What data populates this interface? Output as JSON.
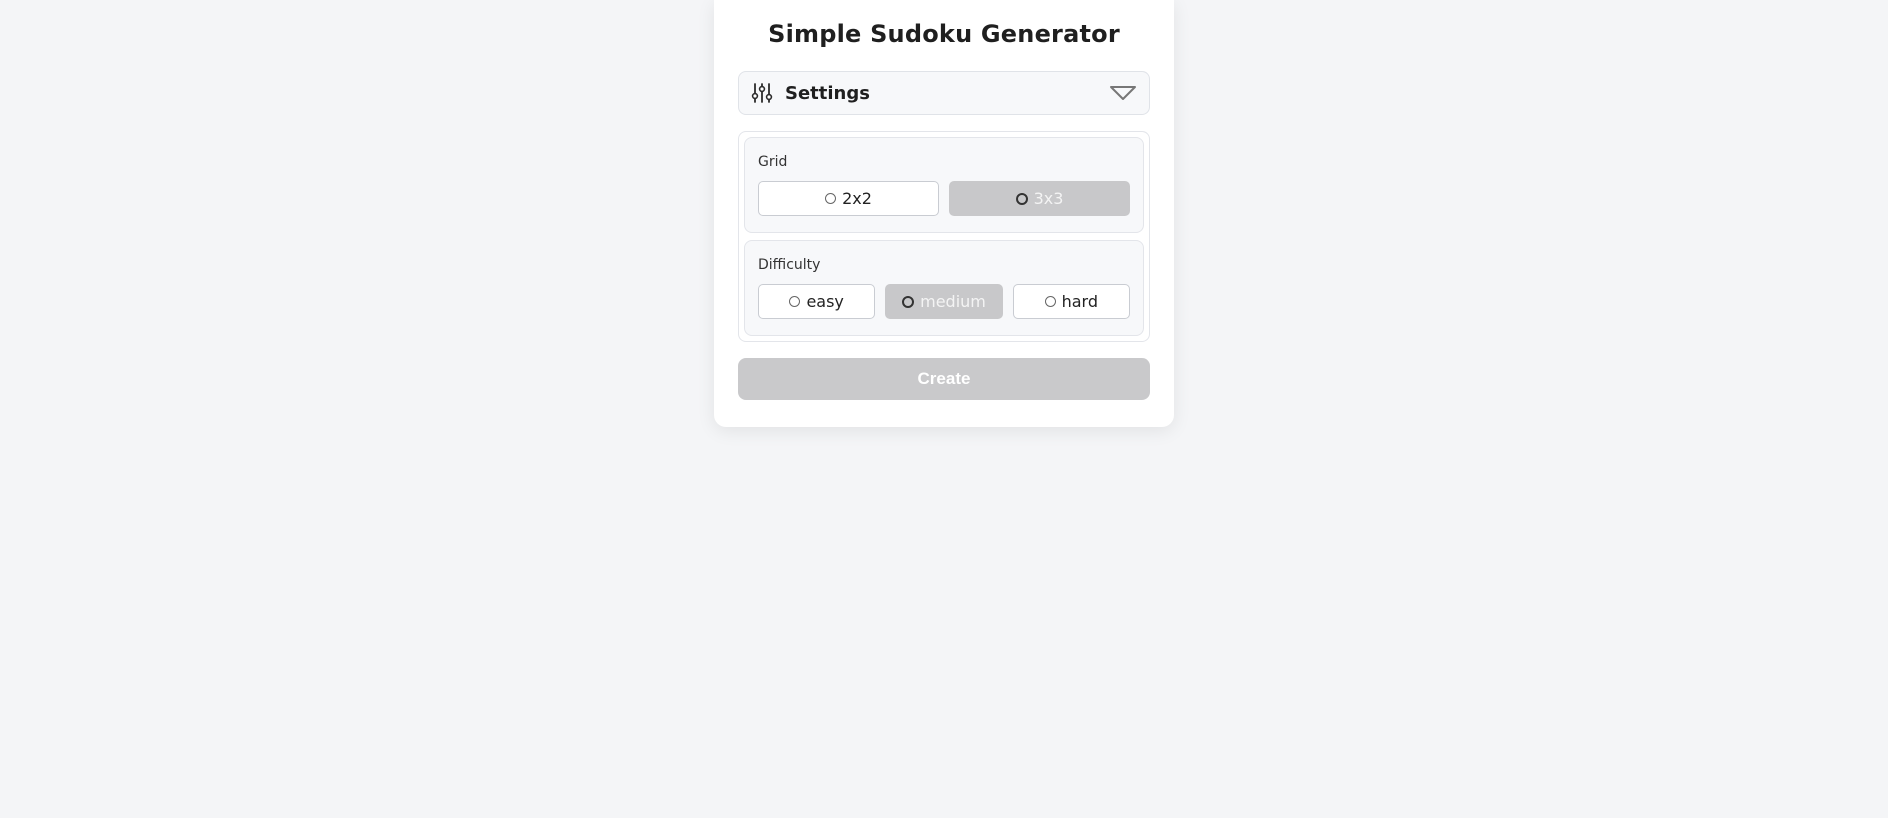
{
  "app": {
    "title": "Simple Sudoku Generator"
  },
  "settings": {
    "label": "Settings",
    "icon": "sliders-icon",
    "toggle_icon": "chevron-down-icon",
    "expanded": true
  },
  "grid": {
    "label": "Grid",
    "options": [
      "2x2",
      "3x3"
    ],
    "selected": "3x3"
  },
  "difficulty": {
    "label": "Difficulty",
    "options": [
      "easy",
      "medium",
      "hard"
    ],
    "selected": "medium"
  },
  "actions": {
    "create_label": "Create",
    "create_enabled": false
  },
  "colors": {
    "background": "#f4f5f7",
    "card": "#ffffff",
    "selected_option": "#c8c8ca",
    "button_disabled": "#c9c9cb"
  }
}
